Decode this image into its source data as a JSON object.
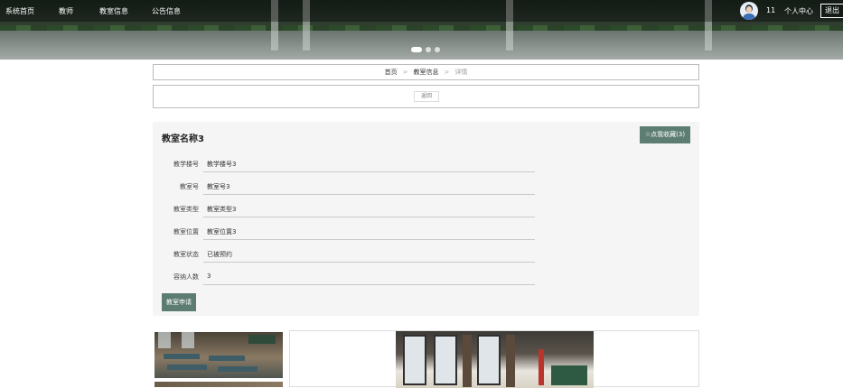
{
  "nav": {
    "items": [
      "系统首页",
      "教师",
      "教室信息",
      "公告信息"
    ],
    "user_id": "11",
    "profile_label": "个人中心",
    "logout_label": "退出"
  },
  "carousel": {
    "slide_count": 3,
    "active_index": 0
  },
  "breadcrumb": {
    "home": "首页",
    "section": "教室信息",
    "current": "详情",
    "separator": ">"
  },
  "back_label": "返回",
  "detail": {
    "title": "教室名称3",
    "favorite_label": "☆点我收藏(3)",
    "fields": [
      {
        "label": "教学楼号",
        "value": "教学楼号3"
      },
      {
        "label": "教室号",
        "value": "教室号3"
      },
      {
        "label": "教室类型",
        "value": "教室类型3"
      },
      {
        "label": "教室位置",
        "value": "教室位置3"
      },
      {
        "label": "教室状态",
        "value": "已被预约"
      },
      {
        "label": "容纳人数",
        "value": "3"
      }
    ],
    "apply_label": "教室申请"
  },
  "colors": {
    "accent": "#5e7d72",
    "panel_bg": "#f5f5f5"
  }
}
